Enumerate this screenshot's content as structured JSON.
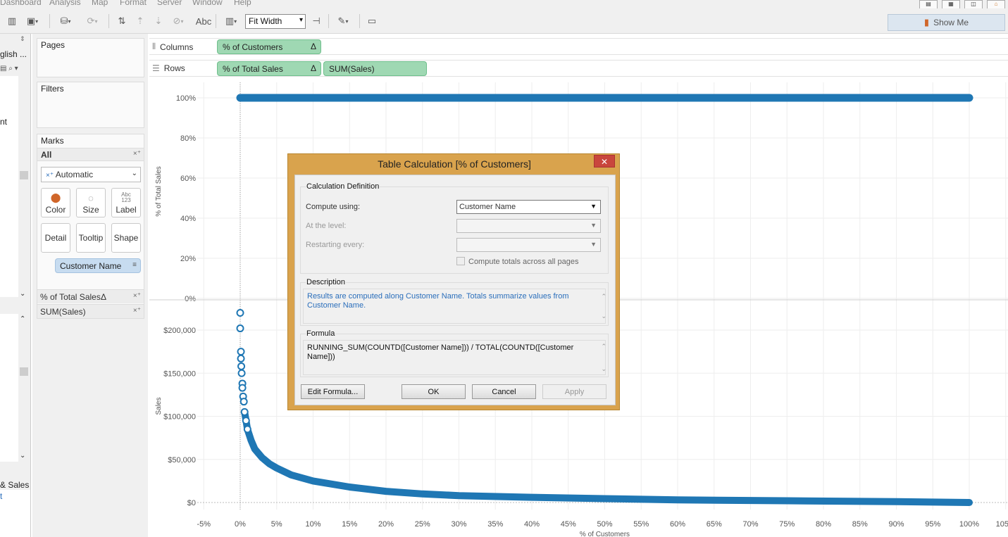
{
  "menu": [
    "Dashboard",
    "Analysis",
    "Map",
    "Format",
    "Server",
    "Window",
    "Help"
  ],
  "toolbar": {
    "abc_label": "Abc",
    "fit_value": "Fit Width",
    "show_me_label": "Show Me"
  },
  "data_pane": {
    "item_1": "glish ...",
    "item_2": "nt",
    "item_3": "& Sales",
    "item_4": "t"
  },
  "shelves": {
    "pages_title": "Pages",
    "filters_title": "Filters",
    "marks_title": "Marks",
    "all_label": "All",
    "mark_type": "Automatic",
    "buttons": {
      "color": "Color",
      "size": "Size",
      "label": "Label",
      "detail": "Detail",
      "tooltip": "Tooltip",
      "shape": "Shape",
      "label_icon": "Abc\n123"
    },
    "detail_pill": "Customer Name",
    "measure_1": "% of Total Sales",
    "measure_1_delta": "Δ",
    "measure_2": "SUM(Sales)"
  },
  "columns_shelf": {
    "label": "Columns",
    "pills": [
      {
        "text": "% of Customers",
        "delta": "Δ"
      }
    ]
  },
  "rows_shelf": {
    "label": "Rows",
    "pills": [
      {
        "text": "% of Total Sales",
        "delta": "Δ"
      },
      {
        "text": "SUM(Sales)",
        "delta": ""
      }
    ]
  },
  "chart_data": [
    {
      "type": "line",
      "title": "",
      "xlabel": "% of Customers",
      "ylabel": "% of Total Sales",
      "x_ticks": [
        "-5%",
        "0%",
        "5%",
        "10%",
        "15%",
        "20%",
        "25%",
        "30%",
        "35%",
        "40%",
        "45%",
        "50%",
        "55%",
        "60%",
        "65%",
        "70%",
        "75%",
        "80%",
        "85%",
        "90%",
        "95%",
        "100%",
        "105%"
      ],
      "y_ticks": [
        "0%",
        "20%",
        "40%",
        "60%",
        "80%",
        "100%"
      ],
      "xlim": [
        -5,
        105
      ],
      "ylim": [
        0,
        100
      ],
      "series": [
        {
          "x": [
            0,
            100
          ],
          "y": [
            100,
            100
          ]
        }
      ],
      "color": "#1f77b4",
      "grid": true
    },
    {
      "type": "scatter",
      "title": "",
      "xlabel": "% of Customers",
      "ylabel": "Sales",
      "y_ticks": [
        "$0",
        "$50,000",
        "$100,000",
        "$150,000",
        "$200,000"
      ],
      "xlim": [
        -5,
        105
      ],
      "ylim": [
        0,
        200000
      ],
      "series": [
        {
          "x": [
            0,
            0,
            0.1,
            0.1,
            0.15,
            0.2,
            0.3,
            0.3,
            0.4,
            0.5,
            0.6,
            0.8,
            1,
            1.5,
            2,
            3,
            4,
            5,
            7,
            10,
            15,
            20,
            25,
            30,
            40,
            50,
            60,
            75,
            90,
            100
          ],
          "y": [
            220000,
            202000,
            175000,
            167000,
            158000,
            150000,
            138000,
            133000,
            123000,
            117000,
            105000,
            95000,
            85000,
            72000,
            62000,
            52000,
            45000,
            40000,
            32000,
            25000,
            18000,
            13000,
            10000,
            8000,
            6000,
            4500,
            3000,
            2000,
            1000,
            0
          ]
        }
      ],
      "color": "#1f77b4",
      "grid": true
    }
  ],
  "dialog": {
    "title": "Table Calculation [% of Customers]",
    "close_label": "✕",
    "calc_def_title": "Calculation Definition",
    "compute_using_label": "Compute using:",
    "compute_using_value": "Customer Name",
    "at_level_label": "At the level:",
    "restarting_label": "Restarting every:",
    "compute_totals_label": "Compute totals across all pages",
    "description_title": "Description",
    "description_text": "Results are computed along Customer Name.  Totals summarize values from Customer Name.",
    "formula_title": "Formula",
    "formula_text": "RUNNING_SUM(COUNTD([Customer Name])) / TOTAL(COUNTD([Customer Name]))",
    "edit_formula_label": "Edit Formula...",
    "ok_label": "OK",
    "cancel_label": "Cancel",
    "apply_label": "Apply"
  }
}
